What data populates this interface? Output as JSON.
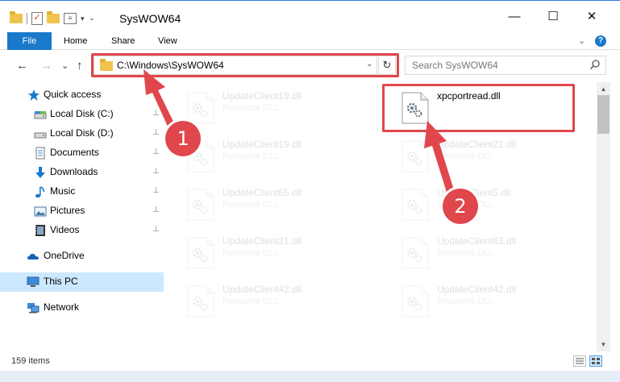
{
  "window": {
    "title": "SysWOW64",
    "minimize_glyph": "—",
    "maximize_glyph": "☐",
    "close_glyph": "✕"
  },
  "quick_access_toolbar": {
    "check_glyph": "✓",
    "dropdown_glyph": "▾"
  },
  "ribbon": {
    "tabs": [
      "File",
      "Home",
      "Share",
      "View"
    ],
    "expand_glyph": "⌄",
    "help_glyph": "?"
  },
  "navigation": {
    "back_glyph": "←",
    "forward_glyph": "→",
    "recent_glyph": "⌄",
    "up_glyph": "↑",
    "address": "C:\\Windows\\SysWOW64",
    "address_dropdown_glyph": "⌄",
    "refresh_glyph": "↻",
    "search_placeholder": "Search SysWOW64"
  },
  "sidebar": {
    "quick_access": "Quick access",
    "items": [
      {
        "label": "Local Disk (C:)",
        "icon": "drive-icon"
      },
      {
        "label": "Local Disk (D:)",
        "icon": "drive-icon"
      },
      {
        "label": "Documents",
        "icon": "documents-icon"
      },
      {
        "label": "Downloads",
        "icon": "downloads-icon"
      },
      {
        "label": "Music",
        "icon": "music-icon"
      },
      {
        "label": "Pictures",
        "icon": "pictures-icon"
      },
      {
        "label": "Videos",
        "icon": "videos-icon"
      }
    ],
    "pin_glyph": "📌",
    "onedrive": "OneDrive",
    "this_pc": "This PC",
    "network": "Network"
  },
  "files": [
    {
      "name": "UpdateClient19.dll",
      "type": "Resource DLL",
      "faded": true
    },
    {
      "name": "xpcportread.dll",
      "type": "",
      "faded": false
    },
    {
      "name": "UpdateClient19.dll",
      "type": "Resource DLL",
      "faded": true
    },
    {
      "name": "UpdateClient21.dll",
      "type": "Resource DLL",
      "faded": true
    },
    {
      "name": "UpdateClient65.dll",
      "type": "Resource DLL",
      "faded": true
    },
    {
      "name": "UpdateClient5.dll",
      "type": "Resource DLL",
      "faded": true
    },
    {
      "name": "UpdateClient21.dll",
      "type": "Resource DLL",
      "faded": true
    },
    {
      "name": "UpdateClient63.dll",
      "type": "Resource DLL",
      "faded": true
    },
    {
      "name": "UpdateClient42.dll",
      "type": "Resource DLL",
      "faded": true
    },
    {
      "name": "UpdateClient42.dll",
      "type": "Resource DLL",
      "faded": true
    }
  ],
  "scrollbar": {
    "up_glyph": "▲",
    "down_glyph": "▼"
  },
  "status": {
    "item_count": "159 items"
  },
  "annotations": {
    "step1": "1",
    "step2": "2",
    "color": "#e0474c"
  },
  "colors": {
    "accent": "#1979ca",
    "selection": "#cce8ff",
    "highlight": "#e0474c"
  }
}
